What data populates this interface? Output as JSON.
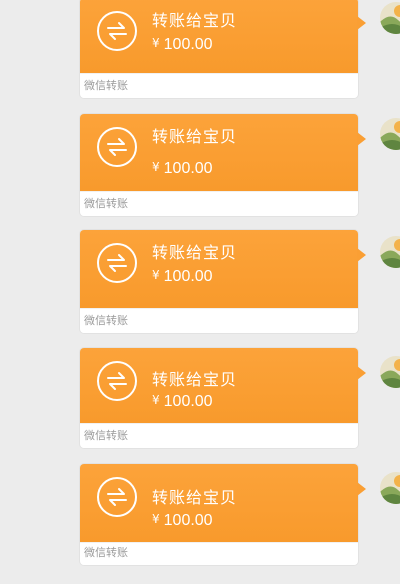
{
  "chat": {
    "messages": [
      {
        "title": "转账给宝贝",
        "currency": "¥",
        "amount": "100.00",
        "footer": "微信转账"
      },
      {
        "title": "转账给宝贝",
        "currency": "¥",
        "amount": "100.00",
        "footer": "微信转账"
      },
      {
        "title": "转账给宝贝",
        "currency": "¥",
        "amount": "100.00",
        "footer": "微信转账"
      },
      {
        "title": "转账给宝贝",
        "currency": "¥",
        "amount": "100.00",
        "footer": "微信转账"
      },
      {
        "title": "转账给宝贝",
        "currency": "¥",
        "amount": "100.00",
        "footer": "微信转账"
      }
    ]
  },
  "colors": {
    "bubble": "#f89a2c",
    "background": "#ececec",
    "footer_text": "#9a9a9a"
  },
  "icons": {
    "transfer": "transfer-arrows-icon",
    "avatar": "avatar-image"
  }
}
